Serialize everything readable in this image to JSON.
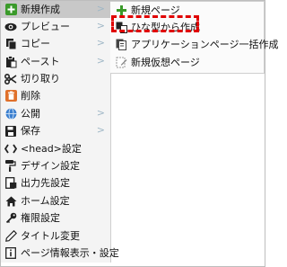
{
  "menu": {
    "items": [
      {
        "label": "新規作成",
        "icon": "green-plus-icon",
        "has_submenu": true
      },
      {
        "label": "プレビュー",
        "icon": "eye-icon",
        "has_submenu": true
      },
      {
        "label": "コピー",
        "icon": "copy-icon",
        "has_submenu": true
      },
      {
        "label": "ペースト",
        "icon": "paste-icon",
        "has_submenu": true
      },
      {
        "label": "切り取り",
        "icon": "scissors-icon",
        "has_submenu": false
      },
      {
        "label": "削除",
        "icon": "trash-icon",
        "has_submenu": false
      },
      {
        "label": "公開",
        "icon": "globe-icon",
        "has_submenu": true
      },
      {
        "label": "保存",
        "icon": "floppy-disk-icon",
        "has_submenu": true
      },
      {
        "label": "<head>設定",
        "icon": "code-icon",
        "has_submenu": false
      },
      {
        "label": "デザイン設定",
        "icon": "paint-roller-icon",
        "has_submenu": false
      },
      {
        "label": "出力先設定",
        "icon": "output-icon",
        "has_submenu": false
      },
      {
        "label": "ホーム設定",
        "icon": "home-icon",
        "has_submenu": false
      },
      {
        "label": "権限設定",
        "icon": "key-icon",
        "has_submenu": false
      },
      {
        "label": "タイトル変更",
        "icon": "pencil-icon",
        "has_submenu": false
      },
      {
        "label": "ページ情報表示・設定",
        "icon": "info-icon",
        "has_submenu": false
      }
    ],
    "submenu_arrow": ">"
  },
  "submenu": {
    "items": [
      {
        "label": "新規ページ",
        "icon": "green-plus-icon"
      },
      {
        "label": "ひな型から作成",
        "icon": "template-icon"
      },
      {
        "label": "アプリケーションページ一括作成",
        "icon": "bulk-create-icon"
      },
      {
        "label": "新規仮想ページ",
        "icon": "virtual-page-icon"
      }
    ]
  },
  "colors": {
    "highlight_dash": "#e00000",
    "plus_green": "#3a9a2a",
    "arrow": "#9fb7c6"
  }
}
